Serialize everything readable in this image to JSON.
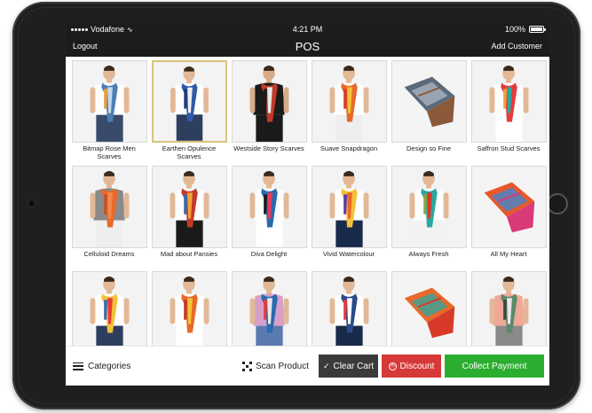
{
  "statusbar": {
    "carrier": "Vodafone",
    "time": "4:21 PM",
    "battery": "100%",
    "battery_level": 1.0
  },
  "navbar": {
    "left": "Logout",
    "title": "POS",
    "right": "Add Customer"
  },
  "colors": {
    "bar": "#1c1c1c",
    "clear": "#3b3b3b",
    "discount": "#d63a38",
    "collect": "#2bae2f",
    "selected": "#d8c47a"
  },
  "products": [
    {
      "label": "Bitmap Rose Men Scarves",
      "selected": false,
      "skin": "#e2b896",
      "top": "#ffffff",
      "scarf": [
        "#4a7fb5",
        "#c9d8e6",
        "#e8a23a"
      ],
      "bottom": "#3a4a6a"
    },
    {
      "label": "Earthen Opulence Scarves",
      "selected": true,
      "skin": "#e2b896",
      "top": "#ffffff",
      "scarf": [
        "#2f5aa8",
        "#f0f0f0",
        "#1d3a78"
      ],
      "bottom": "#2e3e5e"
    },
    {
      "label": "Westside Story Scarves",
      "selected": false,
      "skin": "#d9ac88",
      "top": "#1a1a1a",
      "scarf": [
        "#c23a2a",
        "#e8e8e8",
        "#1a1a1a"
      ],
      "bottom": "#1a1a1a"
    },
    {
      "label": "Suave Snapdragon",
      "selected": false,
      "skin": "#e2b896",
      "top": "#ffffff",
      "scarf": [
        "#e8692a",
        "#f3c23a",
        "#d83a2a"
      ],
      "bottom": "#eeeeee"
    },
    {
      "label": "Design so Fine",
      "selected": false,
      "skin": "#f2f2f2",
      "top": "#f2f2f2",
      "scarf": [
        "#5a6a7a",
        "#b0b8c4",
        "#8a5a3a"
      ],
      "bottom": "#f2f2f2"
    },
    {
      "label": "Saffron Stud Scarves",
      "selected": false,
      "skin": "#e2b896",
      "top": "#ffffff",
      "scarf": [
        "#e83a3a",
        "#2aa8a0",
        "#f3a23a"
      ],
      "bottom": "#ffffff"
    },
    {
      "label": "Celluloid Dreams",
      "selected": false,
      "skin": "#e2b896",
      "top": "#8a8a8a",
      "scarf": [
        "#e8692a",
        "#f08a4a",
        "#c2502a"
      ],
      "bottom": "#eeeeee"
    },
    {
      "label": "Mad about Pansies",
      "selected": false,
      "skin": "#e2b896",
      "top": "#ffffff",
      "scarf": [
        "#c23a2a",
        "#f3a23a",
        "#3a6ab0"
      ],
      "bottom": "#1a1a1a"
    },
    {
      "label": "Diva Delight",
      "selected": false,
      "skin": "#e2b896",
      "top": "#ffffff",
      "scarf": [
        "#2a6ab0",
        "#e83a5a",
        "#1a1a1a"
      ],
      "bottom": "#ffffff"
    },
    {
      "label": "Vivid Watercolour",
      "selected": false,
      "skin": "#e2b896",
      "top": "#ffffff",
      "scarf": [
        "#f3c23a",
        "#e8692a",
        "#5a3aa8"
      ],
      "bottom": "#1a2a4a"
    },
    {
      "label": "Always Fresh",
      "selected": false,
      "skin": "#e2b896",
      "top": "#ffffff",
      "scarf": [
        "#2aa8a0",
        "#d83a2a",
        "#8aa83a"
      ],
      "bottom": "#f2f2f2"
    },
    {
      "label": "All My Heart",
      "selected": false,
      "skin": "#f2f2f2",
      "top": "#f2f2f2",
      "scarf": [
        "#e8582a",
        "#3a8ad8",
        "#d83a7a"
      ],
      "bottom": "#f2f2f2"
    },
    {
      "label": "",
      "selected": false,
      "skin": "#e2b896",
      "top": "#ffffff",
      "scarf": [
        "#f3c23a",
        "#e83a3a",
        "#3a6ab0"
      ],
      "bottom": "#2e3e5e"
    },
    {
      "label": "",
      "selected": false,
      "skin": "#e2b896",
      "top": "#ffffff",
      "scarf": [
        "#e8692a",
        "#f3c23a",
        "#c23a2a"
      ],
      "bottom": "#ffffff"
    },
    {
      "label": "",
      "selected": false,
      "skin": "#e2b896",
      "top": "#d8a0c8",
      "scarf": [
        "#2a6ab0",
        "#e8e8e8",
        "#e83a3a"
      ],
      "bottom": "#5a7ab0"
    },
    {
      "label": "",
      "selected": false,
      "skin": "#e2b896",
      "top": "#ffffff",
      "scarf": [
        "#2a4a8a",
        "#ffffff",
        "#e83a3a"
      ],
      "bottom": "#1a2a4a"
    },
    {
      "label": "",
      "selected": false,
      "skin": "#f2f2f2",
      "top": "#f2f2f2",
      "scarf": [
        "#e8692a",
        "#2aa8a0",
        "#d83a2a"
      ],
      "bottom": "#f2f2f2"
    },
    {
      "label": "",
      "selected": false,
      "skin": "#e2b896",
      "top": "#f0a898",
      "scarf": [
        "#5a8a6a",
        "#e8e8e8",
        "#3a4a3a"
      ],
      "bottom": "#8a8a8a"
    }
  ],
  "bottombar": {
    "categories": "Categories",
    "scan": "Scan Product",
    "clear": "Clear Cart",
    "discount": "Discount",
    "collect": "Collect Payment"
  }
}
